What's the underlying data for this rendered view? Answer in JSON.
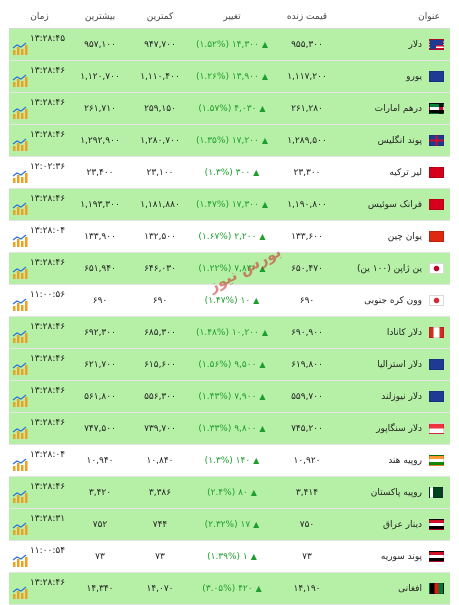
{
  "header": {
    "name": "عنوان",
    "price": "قیمت زنده",
    "change": "تغییر",
    "min": "کمترین",
    "max": "بیشترین",
    "time": "زمان"
  },
  "watermark": "بورس نیوز",
  "colors": {
    "row_green": "#b6f0a6",
    "up_green": "#1e9e2e"
  },
  "rows": [
    {
      "name": "دلار",
      "flag": "flag-us-icon",
      "price": "۹۵۵,۳۰۰",
      "change": "۱۴,۳۰۰ (۱.۵۲%)",
      "up": true,
      "min": "۹۴۷,۷۰۰",
      "max": "۹۵۷,۱۰۰",
      "time": "۱۳:۲۸:۴۵",
      "green": true
    },
    {
      "name": "یورو",
      "flag": "flag-eu-icon",
      "price": "۱,۱۱۷,۲۰۰",
      "change": "۱۳,۹۰۰ (۱.۲۶%)",
      "up": true,
      "min": "۱,۱۱۰,۴۰۰",
      "max": "۱,۱۲۰,۷۰۰",
      "time": "۱۳:۲۸:۴۶",
      "green": true
    },
    {
      "name": "درهم امارات",
      "flag": "flag-ae-icon",
      "price": "۲۶۱,۲۸۰",
      "change": "۴,۰۳۰ (۱.۵۷%)",
      "up": true,
      "min": "۲۵۹,۱۵۰",
      "max": "۲۶۱,۷۱۰",
      "time": "۱۳:۲۸:۴۶",
      "green": true
    },
    {
      "name": "پوند انگلیس",
      "flag": "flag-gb-icon",
      "price": "۱,۲۸۹,۵۰۰",
      "change": "۱۷,۲۰۰ (۱.۳۵%)",
      "up": true,
      "min": "۱,۲۸۰,۷۰۰",
      "max": "۱,۲۹۲,۹۰۰",
      "time": "۱۳:۲۸:۴۶",
      "green": true
    },
    {
      "name": "لیر ترکیه",
      "flag": "flag-tr-icon",
      "price": "۲۳,۳۰۰",
      "change": "۳۰۰ (۱.۳%)",
      "up": true,
      "min": "۲۳,۱۰۰",
      "max": "۲۳,۴۰۰",
      "time": "۱۲:۰۲:۳۶",
      "green": false
    },
    {
      "name": "فرانک سوئیس",
      "flag": "flag-ch-icon",
      "price": "۱,۱۹۰,۸۰۰",
      "change": "۱۷,۳۰۰ (۱.۴۷%)",
      "up": true,
      "min": "۱,۱۸۱,۸۸۰",
      "max": "۱,۱۹۳,۳۰۰",
      "time": "۱۳:۲۸:۴۶",
      "green": true
    },
    {
      "name": "یوان چین",
      "flag": "flag-cn-icon",
      "price": "۱۳۳,۶۰۰",
      "change": "۲,۲۰۰ (۱.۶۷%)",
      "up": true,
      "min": "۱۳۲,۵۰۰",
      "max": "۱۳۳,۹۰۰",
      "time": "۱۳:۲۸:۰۴",
      "green": false
    },
    {
      "name": "ین ژاپن (۱۰۰ ین)",
      "flag": "flag-jp-icon",
      "price": "۶۵۰,۴۷۰",
      "change": "۷,۸۳۰ (۱.۲۲%)",
      "up": true,
      "min": "۶۴۶,۰۳۰",
      "max": "۶۵۱,۹۴۰",
      "time": "۱۳:۲۸:۴۶",
      "green": true
    },
    {
      "name": "وون کره جنوبی",
      "flag": "flag-kr-icon",
      "price": "۶۹۰",
      "change": "۱۰ (۱.۴۷%)",
      "up": true,
      "min": "۶۹۰",
      "max": "۶۹۰",
      "time": "۱۱:۰۰:۵۶",
      "green": false
    },
    {
      "name": "دلار کانادا",
      "flag": "flag-ca-icon",
      "price": "۶۹۰,۹۰۰",
      "change": "۱۰,۲۰۰ (۱.۴۸%)",
      "up": true,
      "min": "۶۸۵,۳۰۰",
      "max": "۶۹۲,۳۰۰",
      "time": "۱۳:۲۸:۴۶",
      "green": true
    },
    {
      "name": "دلار استرالیا",
      "flag": "flag-au-icon",
      "price": "۶۱۹,۸۰۰",
      "change": "۹,۵۰۰ (۱.۵۶%)",
      "up": true,
      "min": "۶۱۵,۶۰۰",
      "max": "۶۲۱,۷۰۰",
      "time": "۱۳:۲۸:۴۶",
      "green": true
    },
    {
      "name": "دلار نیوزلند",
      "flag": "flag-nz-icon",
      "price": "۵۵۹,۷۰۰",
      "change": "۷,۹۰۰ (۱.۴۳%)",
      "up": true,
      "min": "۵۵۶,۳۰۰",
      "max": "۵۶۱,۸۰۰",
      "time": "۱۳:۲۸:۴۶",
      "green": true
    },
    {
      "name": "دلار سنگاپور",
      "flag": "flag-sg-icon",
      "price": "۷۴۵,۲۰۰",
      "change": "۹,۸۰۰ (۱.۳۳%)",
      "up": true,
      "min": "۷۳۹,۷۰۰",
      "max": "۷۴۷,۵۰۰",
      "time": "۱۳:۲۸:۴۶",
      "green": true
    },
    {
      "name": "روپیه هند",
      "flag": "flag-in-icon",
      "price": "۱۰,۹۲۰",
      "change": "۱۴۰ (۱.۳%)",
      "up": true,
      "min": "۱۰,۸۴۰",
      "max": "۱۰,۹۴۰",
      "time": "۱۳:۲۸:۰۴",
      "green": false
    },
    {
      "name": "روپیه پاکستان",
      "flag": "flag-pk-icon",
      "price": "۳,۴۱۴",
      "change": "۸۰ (۲.۴%)",
      "up": true,
      "min": "۳,۳۸۶",
      "max": "۳,۴۲۰",
      "time": "۱۳:۲۸:۴۶",
      "green": true
    },
    {
      "name": "دینار عراق",
      "flag": "flag-iq-icon",
      "price": "۷۵۰",
      "change": "۱۷ (۲.۳۲%)",
      "up": true,
      "min": "۷۴۴",
      "max": "۷۵۲",
      "time": "۱۳:۲۸:۳۱",
      "green": true
    },
    {
      "name": "پوند سوریه",
      "flag": "flag-sy-icon",
      "price": "۷۳",
      "change": "۱ (۱.۳۹%)",
      "up": true,
      "min": "۷۳",
      "max": "۷۳",
      "time": "۱۱:۰۰:۵۴",
      "green": false
    },
    {
      "name": "افغانی",
      "flag": "flag-af-icon",
      "price": "۱۴,۱۹۰",
      "change": "۴۲۰ (۳.۰۵%)",
      "up": true,
      "min": "۱۴,۰۷۰",
      "max": "۱۴,۳۴۰",
      "time": "۱۳:۲۸:۴۶",
      "green": true
    }
  ]
}
